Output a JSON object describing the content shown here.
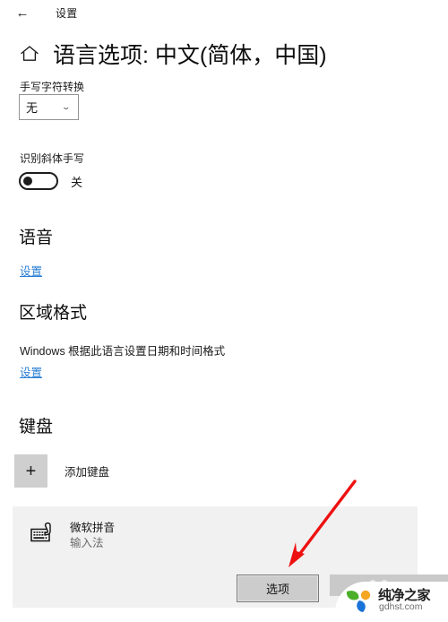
{
  "window": {
    "titlebar_title": "设置",
    "back_icon": "arrow-left-icon"
  },
  "header": {
    "home_icon": "home-icon",
    "title": "语言选项: 中文(简体，中国)"
  },
  "handwriting": {
    "label": "手写字符转换",
    "dropdown_value": "无",
    "chevron_icon": "chevron-down-icon"
  },
  "cursive": {
    "label": "识别斜体手写",
    "toggle_state": "关",
    "toggle_on": false
  },
  "speech": {
    "heading": "语音",
    "link": "设置"
  },
  "region": {
    "heading": "区域格式",
    "description": "Windows 根据此语言设置日期和时间格式",
    "link": "设置"
  },
  "keyboard": {
    "heading": "键盘",
    "add_icon": "plus-icon",
    "add_label": "添加键盘",
    "items": [
      {
        "icon": "keyboard-ime-icon",
        "name": "微软拼音",
        "subtitle": "输入法"
      }
    ],
    "options_button": "选项"
  },
  "annotation": {
    "arrow_color": "#ee1111",
    "arrow_name": "red-pointer-arrow"
  },
  "watermark": {
    "brand": "纯净之家",
    "url": "gdhst.com",
    "colors": {
      "green": "#4caf2a",
      "orange": "#f5a623",
      "blue": "#1a73d9"
    }
  },
  "colors": {
    "accent_link": "#2a7fd4",
    "card_bg": "#f1f1f1",
    "button_bg": "#cccccc"
  }
}
